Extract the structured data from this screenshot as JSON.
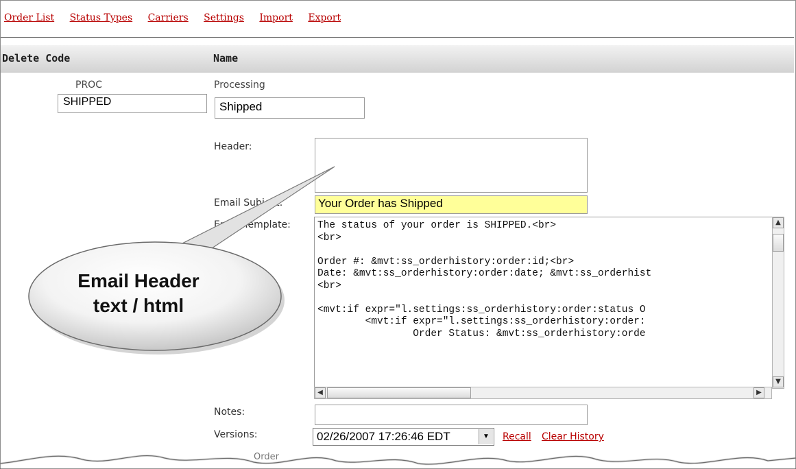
{
  "nav": {
    "items": [
      "Order List",
      "Status Types",
      "Carriers",
      "Settings",
      "Import",
      "Export"
    ]
  },
  "columns": {
    "delete_code": "Delete Code",
    "name": "Name"
  },
  "rows": [
    {
      "code": "PROC",
      "name": "Processing"
    }
  ],
  "edit_row": {
    "code_value": "SHIPPED",
    "name_value": "Shipped"
  },
  "fields": {
    "header_label": "Header:",
    "subject_label": "Email Subject:",
    "subject_value": "Your Order has Shipped",
    "template_label": "Email Template:",
    "template_value": "The status of your order is SHIPPED.<br>\n<br>\n\nOrder #: &mvt:ss_orderhistory:order:id;<br>\nDate: &mvt:ss_orderhistory:order:date; &mvt:ss_orderhist\n<br>\n\n<mvt:if expr=\"l.settings:ss_orderhistory:order:status O\n        <mvt:if expr=\"l.settings:ss_orderhistory:order:\n                Order Status: &mvt:ss_orderhistory:orde",
    "notes_label": "Notes:",
    "versions_label": "Versions:",
    "versions_value": "02/26/2007 17:26:46 EDT",
    "recall": "Recall",
    "clear_history": "Clear History"
  },
  "callout": {
    "line1": "Email Header",
    "line2": "text / html"
  },
  "footer_fragment": "Order"
}
